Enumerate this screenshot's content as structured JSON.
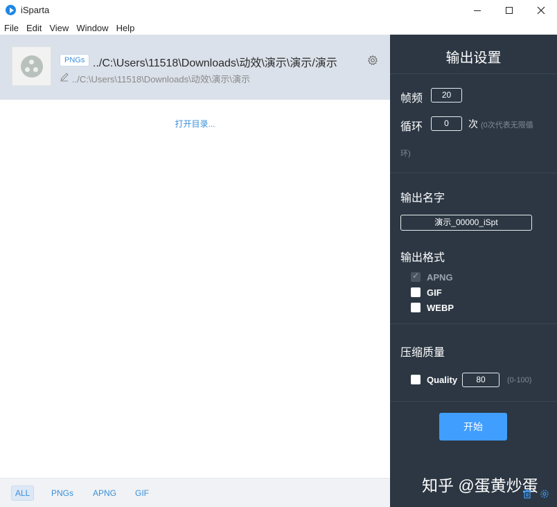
{
  "window": {
    "title": "iSparta",
    "minimize_icon": "minimize-icon",
    "maximize_icon": "maximize-icon",
    "close_icon": "close-icon"
  },
  "menu": [
    "File",
    "Edit",
    "View",
    "Window",
    "Help"
  ],
  "file_item": {
    "tag": "PNGs",
    "path": "../C:\\Users\\11518\\Downloads\\动效\\演示\\演示/演示",
    "output_path": "../C:\\Users\\11518\\Downloads\\动效\\演示\\演示",
    "settings_icon": "gear-icon",
    "edit_icon": "pencil-icon"
  },
  "open_dir_link": "打开目录...",
  "filters": [
    "ALL",
    "PNGs",
    "APNG",
    "GIF"
  ],
  "active_filter": "ALL",
  "settings": {
    "title": "输出设置",
    "frame_rate_label": "帧频",
    "frame_rate_value": "20",
    "loop_label": "循环",
    "loop_value": "0",
    "loop_unit": "次",
    "loop_hint_1": "(0次代表无限循",
    "loop_hint_2": "环)",
    "output_name_label": "输出名字",
    "output_name_value": "演示_00000_iSpt",
    "output_format_label": "输出格式",
    "formats": [
      {
        "label": "APNG",
        "checked": true,
        "disabled": true
      },
      {
        "label": "GIF",
        "checked": false,
        "disabled": false
      },
      {
        "label": "WEBP",
        "checked": false,
        "disabled": false
      }
    ],
    "compress_label": "压缩质量",
    "quality_label": "Quality",
    "quality_value": "80",
    "quality_range": "(0-100)",
    "start_button": "开始"
  },
  "watermark": "知乎 @蛋黄炒蛋",
  "accent_color": "#409eff",
  "panel_bg": "#2c3743"
}
